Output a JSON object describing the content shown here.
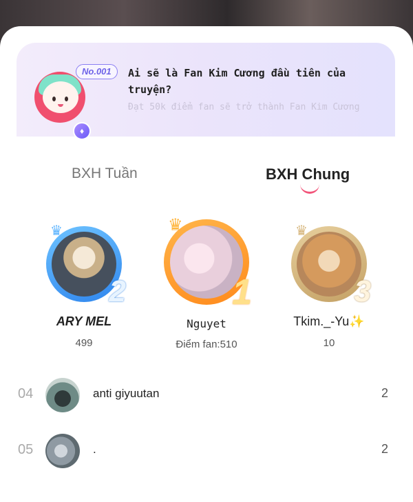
{
  "banner": {
    "badge": "No.001",
    "title": "Ai sẽ là Fan Kim Cương đầu tiên của truyện?",
    "subtitle": "Đạt 50k điểm fan sẽ trở thành Fan Kim Cương"
  },
  "tabs": {
    "weekly": "BXH Tuần",
    "overall": "BXH Chung",
    "active": "overall"
  },
  "podium": [
    {
      "rank": "2",
      "name": "ARY MEL",
      "score": "499"
    },
    {
      "rank": "1",
      "name": "Nguyet",
      "score": "Điểm fan:510"
    },
    {
      "rank": "3",
      "name": "Tkim._-Yu✨",
      "score": "10"
    }
  ],
  "list": [
    {
      "rank": "04",
      "name": "anti giyuutan",
      "score": "2"
    },
    {
      "rank": "05",
      "name": ".",
      "score": "2"
    }
  ],
  "colors": {
    "accent": "#f2557a",
    "gold": "#ff9d2e",
    "silver": "#2f86ee",
    "bronze": "#c4a165"
  }
}
